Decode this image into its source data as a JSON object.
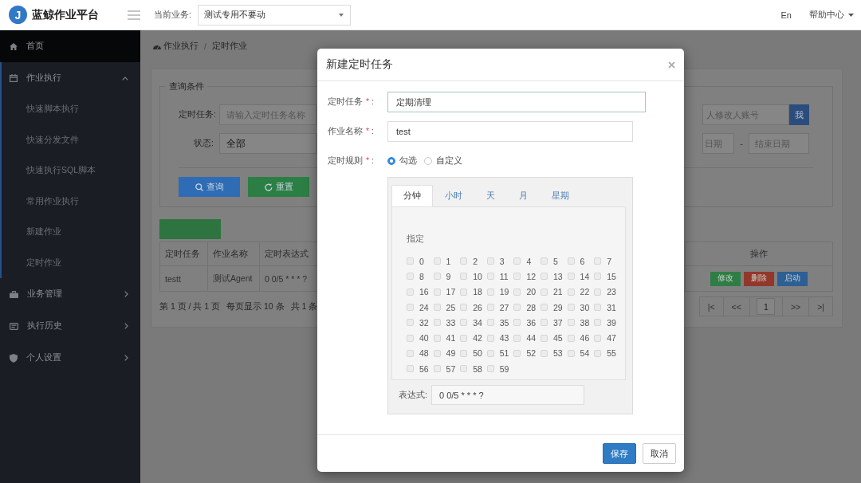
{
  "header": {
    "logo_text": "J",
    "title": "蓝鲸作业平台",
    "business_label": "当前业务:",
    "business_value": "测试专用不要动",
    "language": "En",
    "help": "帮助中心"
  },
  "sidebar": {
    "home": {
      "label": "首页",
      "highlighted": true
    },
    "groups": [
      {
        "label": "作业执行",
        "expanded": true,
        "children": [
          {
            "label": "快速脚本执行"
          },
          {
            "label": "快速分发文件"
          },
          {
            "label": "快速执行SQL脚本"
          },
          {
            "label": "常用作业执行"
          },
          {
            "label": "新建作业"
          },
          {
            "label": "定时作业"
          }
        ]
      },
      {
        "label": "业务管理",
        "expanded": false
      },
      {
        "label": "执行历史",
        "expanded": false
      },
      {
        "label": "个人设置",
        "expanded": false
      }
    ]
  },
  "breadcrumb": {
    "items": [
      "作业执行",
      "定时作业"
    ],
    "separator": "/"
  },
  "query": {
    "legend": "查询条件",
    "task": {
      "label": "定时任务:",
      "placeholder": "请输入定时任务名称"
    },
    "status": {
      "label": "状态:",
      "value": "全部"
    },
    "account": {
      "placeholder": "人修改人账号",
      "button": "我"
    },
    "dates": {
      "start_placeholder": "日期",
      "separator": "-",
      "end_placeholder": "结束日期"
    },
    "buttons": [
      {
        "label": "查询",
        "color": "#2e6cb5"
      },
      {
        "label": "重置",
        "color": "#2b7f45"
      }
    ]
  },
  "table": {
    "columns": [
      "定时任务",
      "作业名称",
      "定时表达式",
      "操作"
    ],
    "rows": [
      {
        "cells": [
          "testt",
          "测试Agent",
          "0 0/5 * * * ?"
        ],
        "actions": [
          {
            "label": "修改",
            "color": "#2f7d45"
          },
          {
            "label": "删除",
            "color": "#93372b"
          },
          {
            "label": "启动",
            "color": "#2d5f94"
          }
        ]
      }
    ]
  },
  "pagination": {
    "summary": [
      "第 1 页 / 共 1 页",
      "每页显示 10 条",
      "共 1 条"
    ],
    "pager": [
      {
        "kind": "button",
        "label": "|<"
      },
      {
        "kind": "button",
        "label": "<<"
      },
      {
        "kind": "input",
        "value": "1"
      },
      {
        "kind": "button",
        "label": ">>"
      },
      {
        "kind": "button",
        "label": ">|"
      }
    ]
  },
  "dialog": {
    "title": "新建定时任务",
    "fields": [
      {
        "label": "定时任务",
        "required_mark": "*",
        "suffix": ":",
        "value": "定期清理",
        "focused": true
      },
      {
        "label": "作业名称",
        "required_mark": "*",
        "suffix": ":",
        "value": "test",
        "focused": false
      }
    ],
    "rule": {
      "label": "定时规则",
      "required_mark": "*",
      "suffix": ":",
      "options": [
        {
          "label": "勾选",
          "selected": true
        },
        {
          "label": "自定义",
          "selected": false
        }
      ]
    },
    "cron": {
      "tabs": [
        {
          "label": "分钟",
          "selected": true
        },
        {
          "label": "小时",
          "selected": false
        },
        {
          "label": "天",
          "selected": false
        },
        {
          "label": "月",
          "selected": false
        },
        {
          "label": "星期",
          "selected": false
        }
      ],
      "mode_label": "指定",
      "minutes": [
        {
          "label": "0",
          "checked": false
        },
        {
          "label": "1",
          "checked": false
        },
        {
          "label": "2",
          "checked": false
        },
        {
          "label": "3",
          "checked": false
        },
        {
          "label": "4",
          "checked": false
        },
        {
          "label": "5",
          "checked": false
        },
        {
          "label": "6",
          "checked": false
        },
        {
          "label": "7",
          "checked": false
        },
        {
          "label": "8",
          "checked": false
        },
        {
          "label": "9",
          "checked": false
        },
        {
          "label": "10",
          "checked": false
        },
        {
          "label": "11",
          "checked": false
        },
        {
          "label": "12",
          "checked": false
        },
        {
          "label": "13",
          "checked": false
        },
        {
          "label": "14",
          "checked": false
        },
        {
          "label": "15",
          "checked": false
        },
        {
          "label": "16",
          "checked": false
        },
        {
          "label": "17",
          "checked": false
        },
        {
          "label": "18",
          "checked": false
        },
        {
          "label": "19",
          "checked": false
        },
        {
          "label": "20",
          "checked": false
        },
        {
          "label": "21",
          "checked": false
        },
        {
          "label": "22",
          "checked": false
        },
        {
          "label": "23",
          "checked": false
        },
        {
          "label": "24",
          "checked": false
        },
        {
          "label": "25",
          "checked": false
        },
        {
          "label": "26",
          "checked": false
        },
        {
          "label": "27",
          "checked": false
        },
        {
          "label": "28",
          "checked": false
        },
        {
          "label": "29",
          "checked": false
        },
        {
          "label": "30",
          "checked": false
        },
        {
          "label": "31",
          "checked": false
        },
        {
          "label": "32",
          "checked": false
        },
        {
          "label": "33",
          "checked": false
        },
        {
          "label": "34",
          "checked": false
        },
        {
          "label": "35",
          "checked": false
        },
        {
          "label": "36",
          "checked": false
        },
        {
          "label": "37",
          "checked": false
        },
        {
          "label": "38",
          "checked": false
        },
        {
          "label": "39",
          "checked": false
        },
        {
          "label": "40",
          "checked": false
        },
        {
          "label": "41",
          "checked": false
        },
        {
          "label": "42",
          "checked": false
        },
        {
          "label": "43",
          "checked": false
        },
        {
          "label": "44",
          "checked": false
        },
        {
          "label": "45",
          "checked": false
        },
        {
          "label": "46",
          "checked": false
        },
        {
          "label": "47",
          "checked": false
        },
        {
          "label": "48",
          "checked": false
        },
        {
          "label": "49",
          "checked": false
        },
        {
          "label": "50",
          "checked": false
        },
        {
          "label": "51",
          "checked": false
        },
        {
          "label": "52",
          "checked": false
        },
        {
          "label": "53",
          "checked": false
        },
        {
          "label": "54",
          "checked": false
        },
        {
          "label": "55",
          "checked": false
        },
        {
          "label": "56",
          "checked": false
        },
        {
          "label": "57",
          "checked": false
        },
        {
          "label": "58",
          "checked": false
        },
        {
          "label": "59",
          "checked": false
        }
      ],
      "expression_label": "表达式:",
      "expression": "0 0/5 * * * ?"
    },
    "buttons": [
      {
        "label": "保存",
        "kind": "primary"
      },
      {
        "label": "取消",
        "kind": "default"
      }
    ]
  }
}
